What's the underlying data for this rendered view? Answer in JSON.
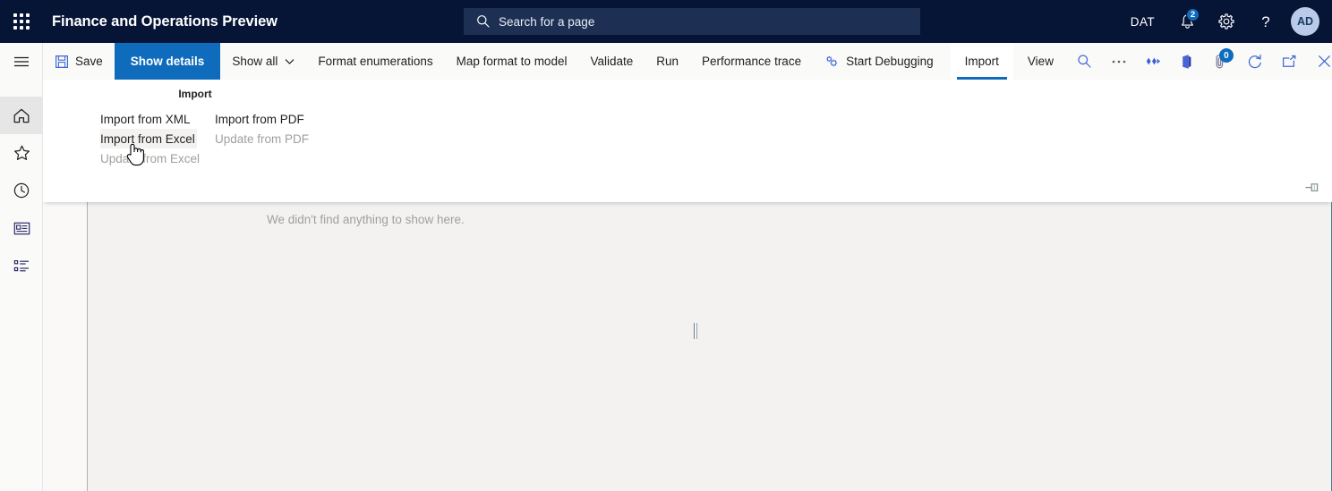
{
  "header": {
    "waffle_label": "app-launcher",
    "title": "Finance and Operations Preview",
    "search": {
      "placeholder": "Search for a page",
      "value": ""
    },
    "company_code": "DAT",
    "notifications": {
      "icon": "bell-icon",
      "count": "2"
    },
    "settings": {
      "icon": "gear-icon"
    },
    "help": {
      "icon": "question-mark-icon"
    },
    "avatar": {
      "initials": "AD"
    }
  },
  "navrail": {
    "items": [
      {
        "name": "hamburger-menu",
        "icon": "hamburger-icon",
        "active": false
      },
      {
        "name": "home",
        "icon": "home-icon",
        "active": true
      },
      {
        "name": "favorites",
        "icon": "star-icon",
        "active": false
      },
      {
        "name": "recent",
        "icon": "clock-icon",
        "active": false
      },
      {
        "name": "workspaces",
        "icon": "workspace-icon",
        "active": false
      },
      {
        "name": "modules",
        "icon": "list-icon",
        "active": false
      }
    ]
  },
  "toolbar": {
    "save_label": "Save",
    "show_details_label": "Show details",
    "show_all_label": "Show all",
    "format_enumerations_label": "Format enumerations",
    "map_format_to_model_label": "Map format to model",
    "validate_label": "Validate",
    "run_label": "Run",
    "performance_trace_label": "Performance trace",
    "start_debugging_label": "Start Debugging",
    "tabs": [
      {
        "label": "Import",
        "active": true
      },
      {
        "label": "View",
        "active": false
      }
    ],
    "right_icons": [
      {
        "name": "filter-search-icon",
        "badge": ""
      },
      {
        "name": "overflow-menu-icon",
        "badge": ""
      },
      {
        "name": "share-icon",
        "badge": ""
      },
      {
        "name": "office-app-icon",
        "badge": ""
      },
      {
        "name": "attachment-icon",
        "badge": "0"
      },
      {
        "name": "refresh-icon",
        "badge": ""
      },
      {
        "name": "popout-icon",
        "badge": ""
      },
      {
        "name": "close-icon",
        "badge": ""
      }
    ]
  },
  "import_panel": {
    "group_title": "Import",
    "left_column": [
      {
        "label": "Import from XML",
        "disabled": false,
        "hovered": false
      },
      {
        "label": "Import from Excel",
        "disabled": false,
        "hovered": true
      },
      {
        "label": "Update from Excel",
        "disabled": true,
        "hovered": false
      }
    ],
    "right_column": [
      {
        "label": "Import from PDF",
        "disabled": false,
        "hovered": false
      },
      {
        "label": "Update from PDF",
        "disabled": true,
        "hovered": false
      }
    ],
    "pin_icon": "pin-icon"
  },
  "content": {
    "empty_message": "We didn't find anything to show here."
  },
  "colors": {
    "header_bg": "#061436",
    "search_bg": "#1d3054",
    "accent_blue": "#0f6cbd",
    "toolbar_bg": "#fafaf9",
    "content_bg": "#f3f2f1",
    "disabled_text": "#a19f9d"
  }
}
